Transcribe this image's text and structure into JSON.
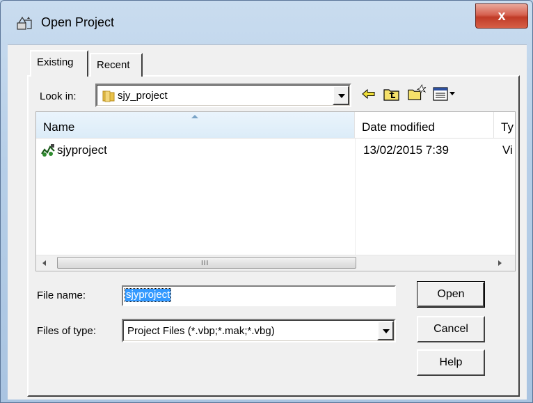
{
  "window": {
    "title": "Open Project",
    "close_glyph": "x"
  },
  "tabs": [
    {
      "label": "Existing",
      "active": true
    },
    {
      "label": "Recent",
      "active": false
    }
  ],
  "look_in": {
    "label": "Look in:",
    "value": "sjy_project"
  },
  "toolbar_icons": [
    "back-arrow-icon",
    "up-one-level-icon",
    "new-folder-icon",
    "view-menu-icon"
  ],
  "list": {
    "columns": [
      "Name",
      "Date modified",
      "Ty"
    ],
    "rows": [
      {
        "name": "sjyproject",
        "date": "13/02/2015 7:39",
        "type": "Vi"
      }
    ],
    "scroll_grip": "III"
  },
  "file_name": {
    "label": "File name:",
    "value": "sjyproject"
  },
  "files_of_type": {
    "label": "Files of type:",
    "value": "Project Files (*.vbp;*.mak;*.vbg)"
  },
  "buttons": {
    "open": "Open",
    "cancel": "Cancel",
    "help": "Help"
  },
  "colors": {
    "selection": "#3399ff",
    "close_red": "#c03b27",
    "folder_yellow": "#e9c24a"
  }
}
